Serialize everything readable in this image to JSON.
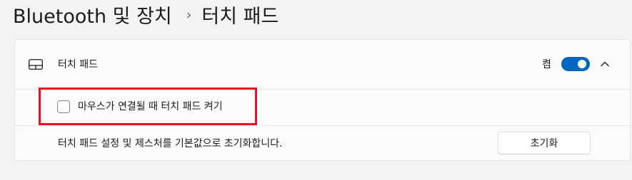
{
  "breadcrumb": {
    "parent": "Bluetooth 및 장치",
    "separator": "›",
    "current": "터치 패드"
  },
  "touchpad_section": {
    "icon": "touchpad-icon",
    "label": "터치 패드",
    "toggle_state_label": "켬",
    "toggle_on": true,
    "expanded": true
  },
  "option": {
    "checkbox_label": "마우스가 연결될 때 터치 패드 켜기",
    "checked": false
  },
  "reset": {
    "description": "터치 패드 설정 및 제스처를 기본값으로 초기화합니다.",
    "button_label": "초기화"
  },
  "colors": {
    "accent": "#0067c0",
    "highlight": "#e81123",
    "background": "#f3f3f3"
  }
}
